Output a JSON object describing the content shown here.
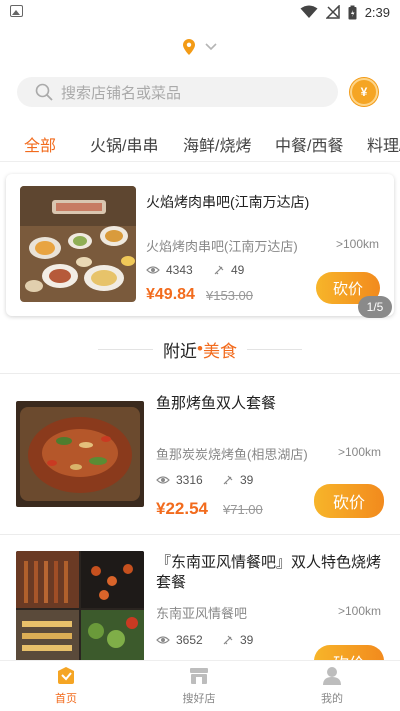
{
  "status_bar": {
    "time": "2:39"
  },
  "location": {
    "text": ""
  },
  "search": {
    "placeholder": "搜索店铺名或菜品",
    "coin_label": "¥"
  },
  "tabs": [
    {
      "label": "全部",
      "active": true
    },
    {
      "label": "火锅/串串"
    },
    {
      "label": "海鲜/烧烤"
    },
    {
      "label": "中餐/西餐"
    },
    {
      "label": "料理/"
    }
  ],
  "featured": {
    "title": "火焰烤肉串吧(江南万达店)",
    "shop": "火焰烤肉串吧(江南万达店)",
    "distance": ">100km",
    "views": "4343",
    "bargains": "49",
    "price": "¥49.84",
    "old_price": "¥153.00",
    "button": "砍价",
    "page": "1/5"
  },
  "section": {
    "title_main": "附近",
    "dot": "•",
    "title_accent": "美食"
  },
  "deals": [
    {
      "title": "鱼那烤鱼双人套餐",
      "shop": "鱼那炭炭烧烤鱼(相思湖店)",
      "distance": ">100km",
      "views": "3316",
      "bargains": "39",
      "price": "¥22.54",
      "old_price": "¥71.00",
      "button": "砍价"
    },
    {
      "title": "『东南亚风情餐吧』双人特色烧烤套餐",
      "shop": "东南亚风情餐吧",
      "distance": ">100km",
      "views": "3652",
      "bargains": "39",
      "button": "砍价"
    }
  ],
  "bottom_nav": [
    {
      "label": "首页",
      "icon": "home-icon",
      "active": true
    },
    {
      "label": "搜好店",
      "icon": "store-icon"
    },
    {
      "label": "我的",
      "icon": "profile-icon"
    }
  ],
  "colors": {
    "accent": "#f26b1d",
    "button_start": "#f7b52a",
    "button_end": "#f28a1d"
  }
}
